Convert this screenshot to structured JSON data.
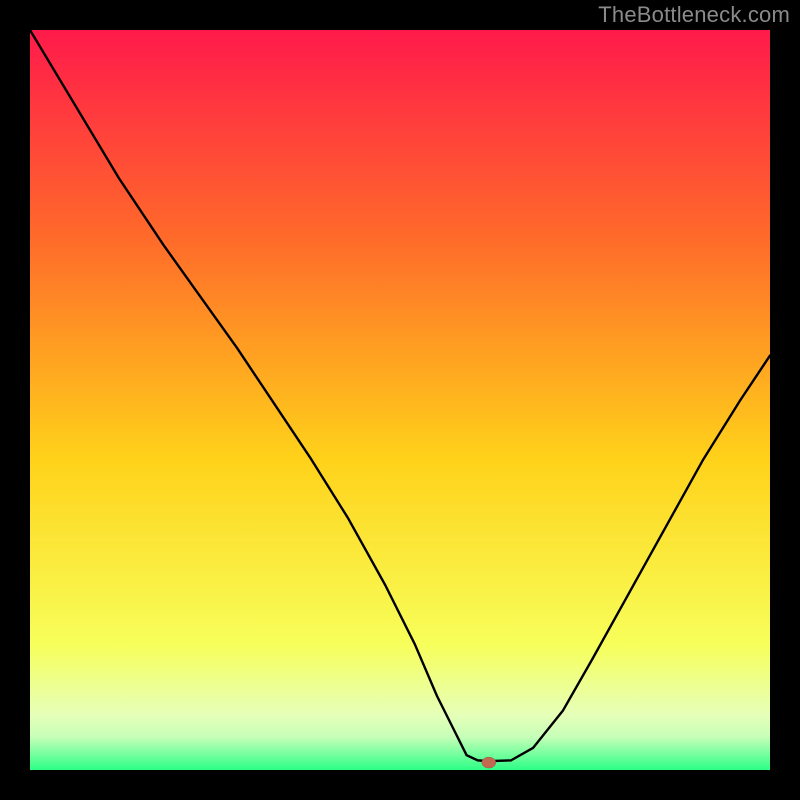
{
  "watermark": "TheBottleneck.com",
  "gradient": {
    "top": "#ff1a4b",
    "upper_mid": "#ff6a2a",
    "mid": "#ffd21a",
    "lower_mid": "#f7ff5a",
    "band_pale": "#e6ffb8",
    "band_pale2": "#c7ffb8",
    "bottom": "#2cff86"
  },
  "chart_data": {
    "type": "line",
    "title": "",
    "xlabel": "",
    "ylabel": "",
    "xlim": [
      0,
      100
    ],
    "ylim": [
      0,
      100
    ],
    "grid": false,
    "legend": false,
    "x": [
      0,
      6,
      12,
      18,
      23,
      28,
      33,
      38,
      43,
      48,
      52,
      55,
      57.5,
      59,
      60.5,
      62,
      65,
      68,
      72,
      76,
      81,
      86,
      91,
      96,
      100
    ],
    "values": [
      100,
      90,
      80,
      71,
      64,
      57,
      49.5,
      42,
      34,
      25,
      17,
      10,
      5,
      2,
      1.3,
      1.2,
      1.3,
      3,
      8,
      15,
      24,
      33,
      42,
      50,
      56
    ],
    "marker": {
      "x": 62,
      "y": 1.0
    },
    "notes": "V-shaped bottleneck curve; minimum (orange dot) near x≈62. Values estimated from pixel positions against 0–100 axes."
  }
}
